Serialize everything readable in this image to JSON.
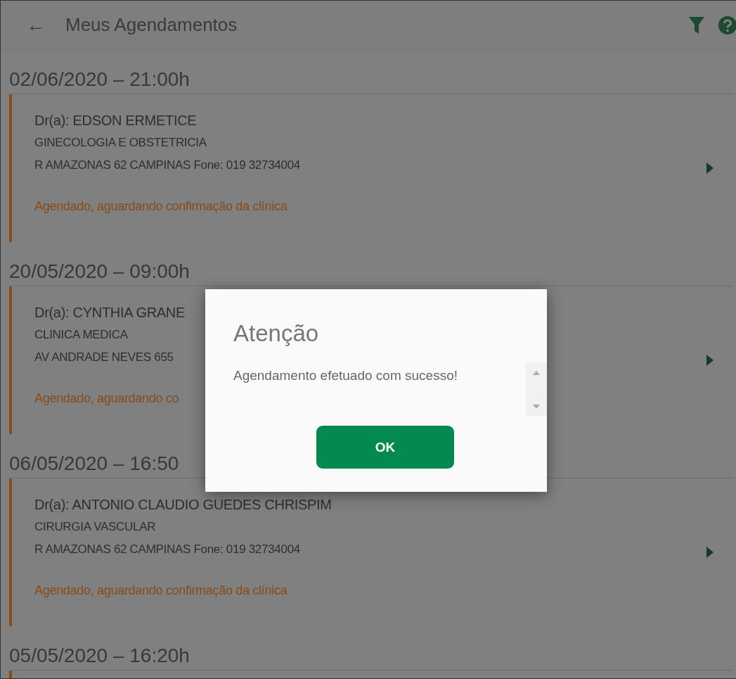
{
  "header": {
    "back_icon": "←",
    "title": "Meus Agendamentos"
  },
  "appointments": [
    {
      "datetime": "02/06/2020 – 21:00h",
      "doctor": "Dr(a): EDSON ERMETICE",
      "specialty": "GINECOLOGIA E OBSTETRICIA",
      "address": "R AMAZONAS 62  CAMPINAS Fone: 019 32734004",
      "status": "Agendado, aguardando confirmação da clínica"
    },
    {
      "datetime": "20/05/2020 – 09:00h",
      "doctor": "Dr(a): CYNTHIA GRANE",
      "specialty": "CLINICA MEDICA",
      "address": "AV ANDRADE NEVES 655",
      "status": "Agendado, aguardando co"
    },
    {
      "datetime": "06/05/2020 – 16:50",
      "doctor": "Dr(a): ANTONIO CLAUDIO GUEDES CHRISPIM",
      "specialty": "CIRURGIA VASCULAR",
      "address": "R AMAZONAS 62  CAMPINAS Fone: 019 32734004",
      "status": "Agendado, aguardando confirmação da clínica"
    },
    {
      "datetime": "05/05/2020 – 16:20h"
    }
  ],
  "dialog": {
    "title": "Atenção",
    "message": "Agendamento efetuado com sucesso!",
    "button": "OK"
  }
}
